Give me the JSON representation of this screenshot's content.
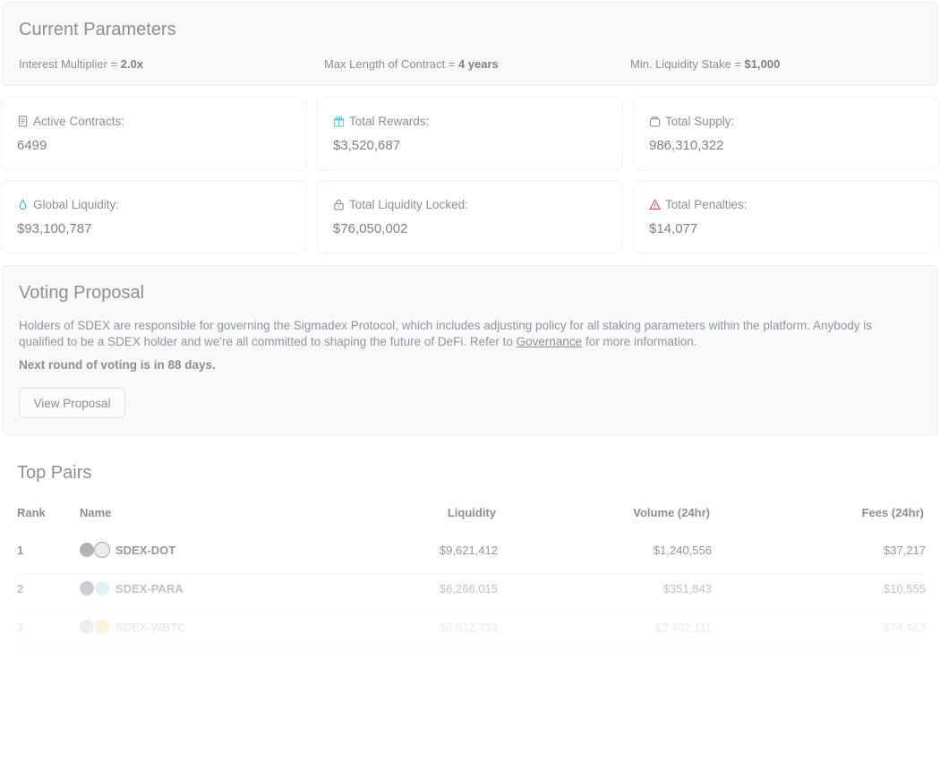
{
  "params": {
    "title": "Current Parameters",
    "items": [
      {
        "label": "Interest Multiplier = ",
        "value": "2.0x"
      },
      {
        "label": "Max Length of Contract = ",
        "value": "4 years"
      },
      {
        "label": "Min. Liquidity Stake = ",
        "value": "$1,000"
      }
    ]
  },
  "stats": [
    {
      "label": "Active Contracts:",
      "value": "6499",
      "icon": "document-icon"
    },
    {
      "label": "Total Rewards:",
      "value": "$3,520,687",
      "icon": "gift-icon"
    },
    {
      "label": "Total Supply:",
      "value": "986,310,322",
      "icon": "jar-icon"
    },
    {
      "label": "Global Liquidity:",
      "value": "$93,100,787",
      "icon": "droplet-icon"
    },
    {
      "label": "Total Liquidity Locked:",
      "value": "$76,050,002",
      "icon": "lock-icon"
    },
    {
      "label": "Total Penalties:",
      "value": "$14,077",
      "icon": "warning-icon"
    }
  ],
  "vote": {
    "title": "Voting Proposal",
    "text_part1": "Holders of SDEX are responsible for governing the Sigmadex Protocol, which includes adjusting policy for all staking parameters within the platform. Anybody is qualified to be a SDEX holder and we're all committed to shaping the future of DeFi. Refer to ",
    "link": "Governance",
    "text_part2": " for more information.",
    "next_round": "Next round of voting is in 88 days.",
    "button": "View Proposal"
  },
  "pairs": {
    "title": "Top Pairs",
    "headers": {
      "rank": "Rank",
      "name": "Name",
      "liquidity": "Liquidity",
      "volume": "Volume (24hr)",
      "fees": "Fees (24hr)"
    },
    "rows": [
      {
        "rank": "1",
        "name": "SDEX-DOT",
        "liquidity": "$9,621,412",
        "volume": "$1,240,556",
        "fees": "$37,217"
      },
      {
        "rank": "2",
        "name": "SDEX-PARA",
        "liquidity": "$6,266,015",
        "volume": "$351,843",
        "fees": "$10,555"
      },
      {
        "rank": "3",
        "name": "SDEX-WBTC",
        "liquidity": "$6,012,333",
        "volume": "$2,482,111",
        "fees": "$74,463"
      }
    ]
  },
  "colors": {
    "gift": "#5ad0df",
    "droplet": "#4aa8e6",
    "warning": "#e05555",
    "token_sdex": "#a9adb3",
    "token_dot": "#9aa0a6",
    "token_para": "#7cc6e0",
    "token_wbtc": "#f6c46a"
  }
}
